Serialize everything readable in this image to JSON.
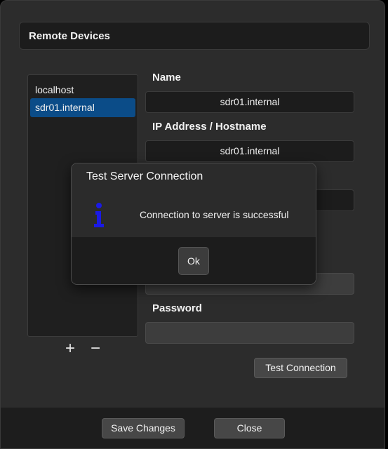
{
  "header": {
    "title": "Remote Devices"
  },
  "devices": [
    {
      "label": "localhost",
      "selected": false
    },
    {
      "label": "sdr01.internal",
      "selected": true
    }
  ],
  "list_controls": {
    "add_label": "+",
    "remove_label": "−"
  },
  "form": {
    "name_label": "Name",
    "name_value": "sdr01.internal",
    "host_label": "IP Address / Hostname",
    "host_value": "sdr01.internal",
    "port_value": "",
    "username_value": "",
    "password_label": "Password",
    "password_value": "",
    "test_button": "Test Connection"
  },
  "footer": {
    "save_label": "Save Changes",
    "close_label": "Close"
  },
  "dialog": {
    "title": "Test Server Connection",
    "icon": "info-icon",
    "message": "Connection to server is successful",
    "ok_label": "Ok"
  },
  "colors": {
    "selection": "#0b4c88",
    "info_icon": "#1a1ae6"
  }
}
